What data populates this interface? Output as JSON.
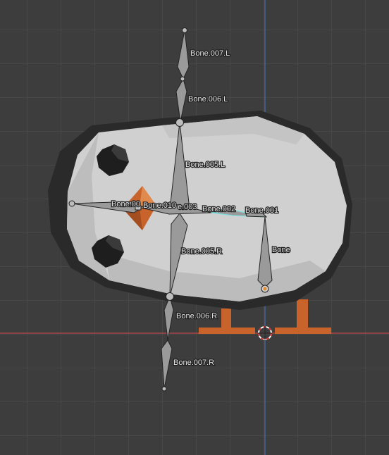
{
  "viewport": {
    "background_color": "#3d3d3d",
    "grid_color": "#474747",
    "x_axis_color": "#b24a4a",
    "y_axis_color": "#4a6fb2"
  },
  "object": {
    "body_color": "#d0d0d0",
    "body_outline_color": "#2a2a2a",
    "eye_color": "#1e1e1e",
    "beak_color": "#c8642b",
    "feet_color": "#c8642b",
    "bone_color": "#9a9a9a",
    "active_bone_color": "#7ee2e2"
  },
  "cursor": {
    "icon": "3d-cursor-icon"
  },
  "bones": [
    {
      "id": "bone-007-l",
      "label": "Bone.007.L"
    },
    {
      "id": "bone-006-l",
      "label": "Bone.006.L"
    },
    {
      "id": "bone-005-l",
      "label": "Bone.005.L"
    },
    {
      "id": "bone-00",
      "label": "Bone.00"
    },
    {
      "id": "bone-010",
      "label": "Bone.010"
    },
    {
      "id": "bone-003",
      "label": "e.003"
    },
    {
      "id": "bone-002",
      "label": "Bone.002"
    },
    {
      "id": "bone-001",
      "label": "Bone.001"
    },
    {
      "id": "bone",
      "label": "Bone"
    },
    {
      "id": "bone-005-r",
      "label": "Bone.005.R"
    },
    {
      "id": "bone-006-r",
      "label": "Bone.006.R"
    },
    {
      "id": "bone-007-r",
      "label": "Bone.007.R"
    }
  ]
}
